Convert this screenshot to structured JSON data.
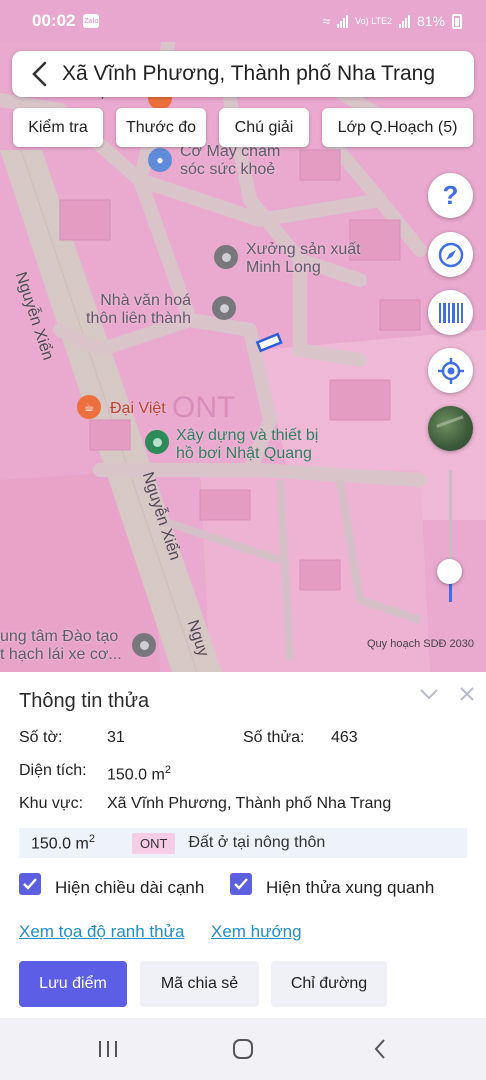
{
  "status_bar": {
    "time": "00:02",
    "app_badge": "Zalo",
    "network": "Vo) LTE2",
    "battery": "81%"
  },
  "header": {
    "title": "Xã Vĩnh Phương, Thành phố Nha Trang"
  },
  "toolbar": {
    "check": "Kiểm tra",
    "measure": "Thước đo",
    "legend": "Chú giải",
    "planning_layers": "Lớp Q.Hoạch (5)"
  },
  "map": {
    "pois": {
      "care": "Cơ Máy chăm\nsóc sức khoẻ",
      "workshop": "Xưởng sản xuất\nMinh Long",
      "culture_house": "Nhà văn hoá\nthôn liên thành",
      "dai_viet": "Đại Việt",
      "pool": "Xây dựng và thiết bị\nhồ bơi Nhật Quang",
      "training": "ung tâm Đào tạo\nt hạch lái xe cơ..."
    },
    "streets": {
      "s1": "Nguyễn Xiển",
      "s2": "Nguyễn Xiển",
      "s3": "Nguy",
      "s4": "Xiển"
    },
    "zone_code": "ONT",
    "attribution": "Quy hoạch SDĐ 2030",
    "layer_slider_level": 0.23
  },
  "panel": {
    "title": "Thông tin thửa",
    "sheet_label": "Số tờ:",
    "sheet_value": "31",
    "parcel_label": "Số thửa:",
    "parcel_value": "463",
    "area_label": "Diện tích:",
    "area_value": "150.0 m",
    "area_unit_sup": "2",
    "region_label": "Khu vực:",
    "region_value": "Xã Vĩnh Phương, Thành phố Nha Trang",
    "land_use": {
      "area": "150.0 m",
      "area_sup": "2",
      "code": "ONT",
      "description": "Đất ở tại nông thôn"
    },
    "checkbox_edges": "Hiện chiều dài cạnh",
    "checkbox_neighbors": "Hiện thửa xung quanh",
    "link_coords": "Xem tọa độ ranh thửa",
    "link_direction": "Xem hướng",
    "btn_save": "Lưu điểm",
    "btn_share": "Mã chia sẻ",
    "btn_directions": "Chỉ đường"
  },
  "colors": {
    "accent": "#5d5ee6",
    "link": "#1f8fc6",
    "map_land": "#eaa9cf",
    "tag_bg": "#f6cde7"
  }
}
